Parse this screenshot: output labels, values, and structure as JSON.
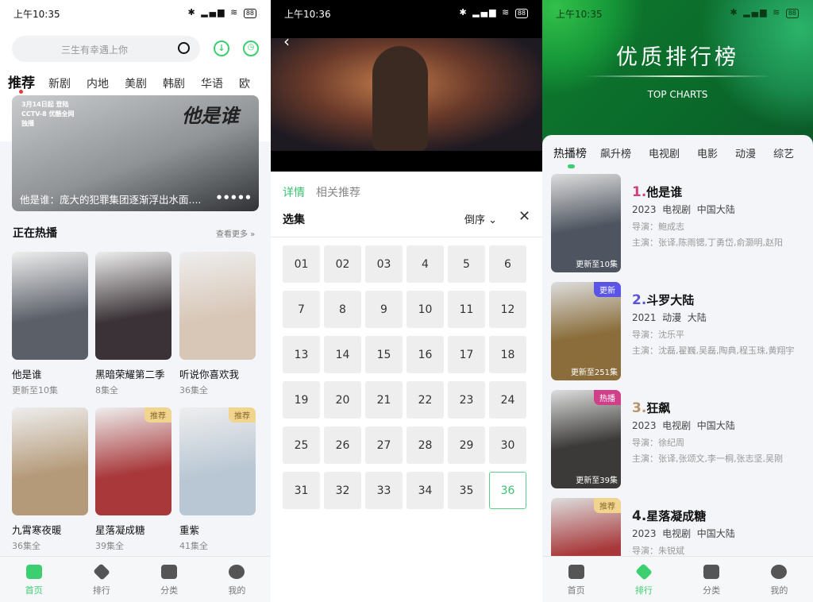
{
  "home": {
    "time": "上午10:35",
    "battery": "88",
    "search_placeholder": "三生有幸遇上你",
    "tabs": [
      "推荐",
      "新剧",
      "内地",
      "美剧",
      "韩剧",
      "华语",
      "欧"
    ],
    "banner": {
      "caption": "他是谁：庞大的犯罪集团逐渐浮出水面....",
      "promo": "3月14日起 登陆CCTV-8 优酷全网独播",
      "logo": "他是谁"
    },
    "section_title": "正在热播",
    "more": "查看更多 »",
    "shows": [
      {
        "title": "他是谁",
        "sub": "更新至10集",
        "badge": "",
        "color": "#5a5f68"
      },
      {
        "title": "黑暗荣耀第二季",
        "sub": "8集全",
        "badge": "",
        "color": "#3a3236"
      },
      {
        "title": "听说你喜欢我",
        "sub": "36集全",
        "badge": "",
        "color": "#d8c7b7"
      },
      {
        "title": "九霄寒夜暖",
        "sub": "36集全",
        "badge": "",
        "color": "#b59a79"
      },
      {
        "title": "星落凝成糖",
        "sub": "39集全",
        "badge": "推荐",
        "color": "#a8383a"
      },
      {
        "title": "重紫",
        "sub": "41集全",
        "badge": "推荐",
        "color": "#b9c7d4"
      }
    ],
    "nav": [
      "首页",
      "排行",
      "分类",
      "我的"
    ]
  },
  "player": {
    "time": "上午10:36",
    "battery": "88",
    "tabs": [
      "详情",
      "相关推荐"
    ],
    "episodes_label": "选集",
    "order": "倒序",
    "episodes": [
      "01",
      "02",
      "03",
      "4",
      "5",
      "6",
      "7",
      "8",
      "9",
      "10",
      "11",
      "12",
      "13",
      "14",
      "15",
      "16",
      "17",
      "18",
      "19",
      "20",
      "21",
      "22",
      "23",
      "24",
      "25",
      "26",
      "27",
      "28",
      "29",
      "30",
      "31",
      "32",
      "33",
      "34",
      "35",
      "36"
    ],
    "selected_episode": "36"
  },
  "charts": {
    "time": "上午10:35",
    "battery": "88",
    "title": "优质排行榜",
    "subtitle": "TOP CHARTS",
    "tabs": [
      "热播榜",
      "飙升榜",
      "电视剧",
      "电影",
      "动漫",
      "综艺"
    ],
    "items": [
      {
        "rank": "1.",
        "rank_color": "#d0417e",
        "title": "他是谁",
        "meta": "2023  电视剧  中国大陆",
        "director": "导演：鲍成志",
        "cast": "主演：张译,陈雨锶,丁勇岱,俞灏明,赵阳",
        "badge": "",
        "badge_color": "",
        "overlay": "更新至10集",
        "color": "#4e5560"
      },
      {
        "rank": "2.",
        "rank_color": "#5b55d6",
        "title": "斗罗大陆",
        "meta": "2021  动漫  大陆",
        "director": "导演：沈乐平",
        "cast": "主演：沈磊,翟巍,吴磊,陶典,程玉珠,黄翔宇",
        "badge": "更新",
        "badge_color": "#5b55e6",
        "overlay": "更新至251集",
        "color": "#8a6d3a"
      },
      {
        "rank": "3.",
        "rank_color": "#b89466",
        "title": "狂飙",
        "meta": "2023  电视剧  中国大陆",
        "director": "导演：徐纪周",
        "cast": "主演：张译,张颂文,李一桐,张志坚,吴刚",
        "badge": "热播",
        "badge_color": "#d0408a",
        "overlay": "更新至39集",
        "color": "#3b3a38"
      },
      {
        "rank": "4.",
        "rank_color": "#222222",
        "title": "星落凝成糖",
        "meta": "2023  电视剧  中国大陆",
        "director": "导演：朱锐斌",
        "cast": "",
        "badge": "推荐",
        "badge_color": "#f1d58e",
        "overlay": "",
        "color": "#a8383a"
      }
    ],
    "nav": [
      "首页",
      "排行",
      "分类",
      "我的"
    ]
  }
}
